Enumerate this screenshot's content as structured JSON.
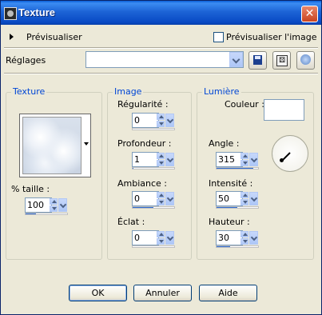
{
  "window": {
    "title": "Texture",
    "close_glyph": "✕"
  },
  "preview": {
    "label": "Prévisualiser",
    "image_label": "Prévisualiser l'image",
    "image_checked": false
  },
  "reglages": {
    "label": "Réglages",
    "value": ""
  },
  "toolbar": {
    "save_icon": "save-icon",
    "random_icon": "dice-icon",
    "reset_icon": "reset-icon"
  },
  "texture": {
    "title": "Texture",
    "size_label": "% taille :",
    "size_value": "100",
    "size_fraction": 0.25
  },
  "image": {
    "title": "Image",
    "regularite_label": "Régularité :",
    "regularite_value": "0",
    "regularite_fraction": 0,
    "profondeur_label": "Profondeur :",
    "profondeur_value": "1",
    "profondeur_fraction": 0.02,
    "ambiance_label": "Ambiance :",
    "ambiance_value": "0",
    "ambiance_fraction": 0.5,
    "eclat_label": "Éclat :",
    "eclat_value": "0",
    "eclat_fraction": 0
  },
  "lumiere": {
    "title": "Lumière",
    "couleur_label": "Couleur :",
    "couleur_value": "#ffffff",
    "angle_label": "Angle :",
    "angle_value": "315",
    "angle_fraction": 0.875,
    "intensite_label": "Intensité :",
    "intensite_value": "50",
    "intensite_fraction": 0.5,
    "hauteur_label": "Hauteur :",
    "hauteur_value": "30",
    "hauteur_fraction": 0.33
  },
  "buttons": {
    "ok": "OK",
    "cancel": "Annuler",
    "help": "Aide"
  }
}
